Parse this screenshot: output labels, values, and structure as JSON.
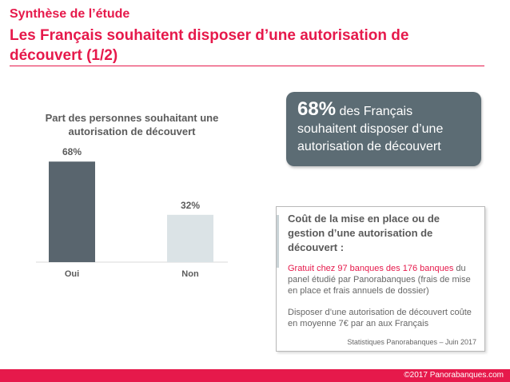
{
  "header": {
    "kicker": "Synthèse de l’étude",
    "headline": "Les Français souhaitent disposer d’une autorisation de découvert (1/2)"
  },
  "colors": {
    "accent": "#e6194b",
    "bar_primary": "#59656e",
    "bar_secondary": "#dbe3e6",
    "callout_bg": "#5c6c74"
  },
  "chart_data": {
    "type": "bar",
    "title": "Part des personnes souhaitant une autorisation de découvert",
    "categories": [
      "Oui",
      "Non"
    ],
    "values": [
      68,
      32
    ],
    "value_labels": [
      "68%",
      "32%"
    ],
    "ylim": [
      0,
      100
    ],
    "grid": false
  },
  "callout": {
    "big": "68%",
    "rest_line1": "des Français",
    "line2": "souhaitent disposer d’une",
    "line3": "autorisation de découvert"
  },
  "info_box": {
    "title": "Coût de la mise en place ou de gestion d’une autorisation de découvert :",
    "highlight": "Gratuit chez 97 banques des 176 banques",
    "text_after_highlight": " du panel étudié par Panorabanques (frais de mise en place et frais annuels de dossier)",
    "paragraph2": "Disposer d’une autorisation de découvert coûte en moyenne 7€ par an aux Français",
    "source": "Statistiques Panorabanques – Juin 2017"
  },
  "footer": {
    "copyright": "©2017 Panorabanques.com"
  }
}
